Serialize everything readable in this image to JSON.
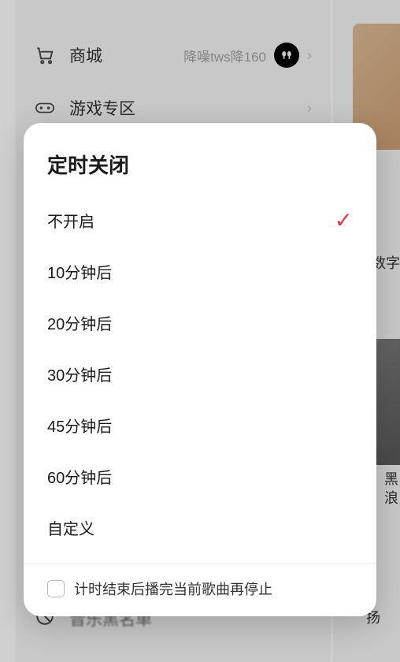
{
  "background": {
    "menu_items": [
      {
        "icon": "cart",
        "label": "商城",
        "subtitle": "降噪tws降160",
        "has_earbuds": true
      },
      {
        "icon": "gamepad",
        "label": "游戏专区",
        "subtitle": "",
        "has_earbuds": false
      }
    ],
    "bottom_partial": "音乐黑名单",
    "right_partial_text1": "数字",
    "right_partial_text2": "黑",
    "right_partial_text3": "浪",
    "right_partial_text4": "扬"
  },
  "modal": {
    "title": "定时关闭",
    "options": [
      {
        "label": "不开启",
        "selected": true
      },
      {
        "label": "10分钟后",
        "selected": false
      },
      {
        "label": "20分钟后",
        "selected": false
      },
      {
        "label": "30分钟后",
        "selected": false
      },
      {
        "label": "45分钟后",
        "selected": false
      },
      {
        "label": "60分钟后",
        "selected": false
      },
      {
        "label": "自定义",
        "selected": false
      }
    ],
    "footer_checkbox_label": "计时结束后播完当前歌曲再停止",
    "footer_checked": false
  }
}
